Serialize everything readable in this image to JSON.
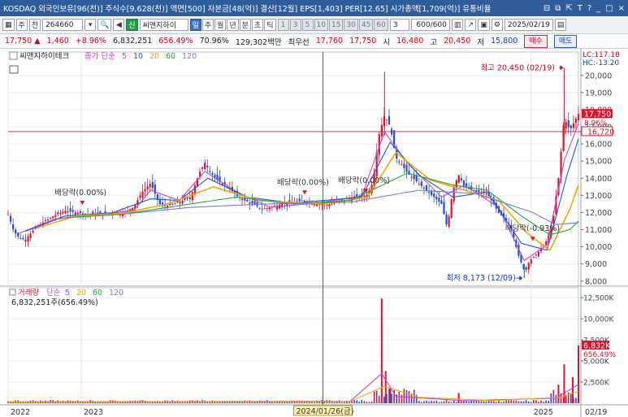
{
  "window": {
    "title": "KOSDAQ 외국인보유[96(천)] 주식수[9,628(천)] 액면[500] 자본금[48(억)] 결산[12월] EPS[1,403] PER[12.65] 시가총액[1,709(억)] 유통비율",
    "icons": [
      "pip-icon",
      "popout-icon",
      "pin-icon",
      "text-size-icon",
      "help-icon",
      "minimize-icon",
      "maximize-icon",
      "close-icon"
    ],
    "icon_glyphs": [
      "⊟",
      "⧉",
      "⇱",
      "T",
      "?",
      "_",
      "□",
      "×"
    ]
  },
  "toolbar": {
    "market": "주",
    "jeon": "전",
    "code": "264660",
    "sin": "신",
    "name": "씨앤지하이",
    "periods": [
      "일",
      "주",
      "월",
      "년",
      "분",
      "초",
      "틱"
    ],
    "minutes": [
      "1",
      "3",
      "5",
      "10",
      "15",
      "30",
      "45",
      "60"
    ],
    "step": "3",
    "count": "600/600",
    "date": "2025/02/19"
  },
  "quote": {
    "price": "17,750",
    "arrow": "▲",
    "change": "1,460",
    "change_pct": "+8.96%",
    "volume": "6,832,251",
    "vol_ratio": "656.49%",
    "turnover": "70.96%",
    "amount": "129,302백만",
    "bid_label": "최우선",
    "bid": "17,760",
    "ask": "17,750",
    "open_label": "시",
    "open": "16,480",
    "high_label": "고",
    "high": "20,450",
    "low_label": "저",
    "low": "15,800",
    "buy_label": "매수",
    "sell_label": "매도"
  },
  "chart_data": [
    {
      "type": "candlestick",
      "title": "씨앤지하이테크",
      "ma_label": "종가 단순",
      "ma_periods": [
        "5",
        "10",
        "20",
        "60",
        "120"
      ],
      "ma_colors": [
        "#d13fd1",
        "#1f57d8",
        "#f0a800",
        "#23a23c",
        "#7b7bd0"
      ],
      "y_ticks": [
        8000,
        9000,
        10000,
        11000,
        12000,
        13000,
        14000,
        15000,
        16000,
        17000,
        18000,
        19000,
        20000
      ],
      "y_tick_labels": [
        "8,000",
        "9,000",
        "10,000",
        "11,000",
        "12,000",
        "13,000",
        "14,000",
        "15,000",
        "16,000",
        "17,000",
        "18,000",
        "19,000",
        "20,000"
      ],
      "ylim": [
        7800,
        20700
      ],
      "x_labels": [
        {
          "label": "2022",
          "t": 0.0
        },
        {
          "label": "2023",
          "t": 0.128
        },
        {
          "label": "2025",
          "t": 0.917
        }
      ],
      "crosshair": {
        "date": "2024/01/26(금)",
        "t": 0.552,
        "price": 16720,
        "price_label": "16,720"
      },
      "last": {
        "price": 17750,
        "price_label": "17,750",
        "pct_label": "8.96%"
      },
      "lc_label": "LC:117.18",
      "hc_label": "HC:-13.20",
      "high": {
        "label": "최고 20,450 (02/19)",
        "value": 20450,
        "t": 0.975
      },
      "low": {
        "label": "최저 8,173 (12/09)",
        "value": 8173,
        "t": 0.905
      },
      "dividends": [
        {
          "label": "배당락(0.00%)",
          "t": 0.13,
          "value": 12450
        },
        {
          "label": "배당락(0.00%)",
          "t": 0.52,
          "value": 13050
        },
        {
          "label": "배당락(0.00%)",
          "t": 0.627,
          "value": 13150
        },
        {
          "label": "배당락(-0.93%)",
          "t": 0.92,
          "value": 10350
        }
      ],
      "close_path": [
        [
          0.0,
          11900
        ],
        [
          0.01,
          10900
        ],
        [
          0.02,
          10500
        ],
        [
          0.03,
          10400
        ],
        [
          0.045,
          11000
        ],
        [
          0.06,
          11400
        ],
        [
          0.08,
          11800
        ],
        [
          0.1,
          12100
        ],
        [
          0.12,
          12000
        ],
        [
          0.14,
          11900
        ],
        [
          0.16,
          11950
        ],
        [
          0.18,
          12000
        ],
        [
          0.2,
          11950
        ],
        [
          0.22,
          12300
        ],
        [
          0.235,
          13200
        ],
        [
          0.25,
          13700
        ],
        [
          0.265,
          12500
        ],
        [
          0.28,
          12400
        ],
        [
          0.3,
          12600
        ],
        [
          0.32,
          12900
        ],
        [
          0.335,
          14300
        ],
        [
          0.345,
          14900
        ],
        [
          0.355,
          14300
        ],
        [
          0.37,
          13800
        ],
        [
          0.385,
          13500
        ],
        [
          0.4,
          13000
        ],
        [
          0.415,
          12700
        ],
        [
          0.43,
          12500
        ],
        [
          0.445,
          12200
        ],
        [
          0.46,
          12300
        ],
        [
          0.48,
          12500
        ],
        [
          0.5,
          12600
        ],
        [
          0.52,
          12700
        ],
        [
          0.54,
          12500
        ],
        [
          0.56,
          12450
        ],
        [
          0.58,
          12650
        ],
        [
          0.6,
          12850
        ],
        [
          0.62,
          12950
        ],
        [
          0.63,
          13050
        ],
        [
          0.64,
          13800
        ],
        [
          0.65,
          16500
        ],
        [
          0.66,
          17700
        ],
        [
          0.67,
          17000
        ],
        [
          0.68,
          15200
        ],
        [
          0.69,
          14800
        ],
        [
          0.7,
          14300
        ],
        [
          0.72,
          13700
        ],
        [
          0.74,
          13100
        ],
        [
          0.76,
          12500
        ],
        [
          0.77,
          11100
        ],
        [
          0.78,
          13400
        ],
        [
          0.79,
          14200
        ],
        [
          0.8,
          13500
        ],
        [
          0.82,
          13200
        ],
        [
          0.84,
          13100
        ],
        [
          0.86,
          12000
        ],
        [
          0.88,
          11300
        ],
        [
          0.895,
          9500
        ],
        [
          0.905,
          8600
        ],
        [
          0.915,
          9200
        ],
        [
          0.93,
          9700
        ],
        [
          0.945,
          10400
        ],
        [
          0.955,
          11500
        ],
        [
          0.965,
          14000
        ],
        [
          0.975,
          17500
        ],
        [
          0.985,
          16800
        ],
        [
          1.0,
          17750
        ]
      ],
      "ma_paths": [
        [
          [
            0.02,
            10800
          ],
          [
            0.08,
            11600
          ],
          [
            0.15,
            11900
          ],
          [
            0.22,
            12100
          ],
          [
            0.25,
            13300
          ],
          [
            0.3,
            12700
          ],
          [
            0.345,
            14400
          ],
          [
            0.4,
            13200
          ],
          [
            0.46,
            12300
          ],
          [
            0.54,
            12550
          ],
          [
            0.62,
            12950
          ],
          [
            0.66,
            16700
          ],
          [
            0.7,
            14900
          ],
          [
            0.76,
            12900
          ],
          [
            0.8,
            13600
          ],
          [
            0.86,
            12300
          ],
          [
            0.905,
            9200
          ],
          [
            0.945,
            10100
          ],
          [
            0.975,
            15000
          ],
          [
            1.0,
            17200
          ]
        ],
        [
          [
            0.03,
            10900
          ],
          [
            0.1,
            11800
          ],
          [
            0.18,
            11950
          ],
          [
            0.25,
            12800
          ],
          [
            0.3,
            12700
          ],
          [
            0.35,
            14000
          ],
          [
            0.42,
            12900
          ],
          [
            0.5,
            12550
          ],
          [
            0.62,
            12900
          ],
          [
            0.67,
            16100
          ],
          [
            0.72,
            14200
          ],
          [
            0.78,
            12900
          ],
          [
            0.84,
            13200
          ],
          [
            0.9,
            10200
          ],
          [
            0.945,
            9800
          ],
          [
            0.98,
            14200
          ],
          [
            1.0,
            16300
          ]
        ],
        [
          [
            0.05,
            11100
          ],
          [
            0.12,
            11800
          ],
          [
            0.2,
            11950
          ],
          [
            0.28,
            12500
          ],
          [
            0.36,
            13500
          ],
          [
            0.44,
            12700
          ],
          [
            0.55,
            12500
          ],
          [
            0.63,
            12900
          ],
          [
            0.68,
            15500
          ],
          [
            0.74,
            13900
          ],
          [
            0.8,
            13300
          ],
          [
            0.86,
            12700
          ],
          [
            0.91,
            10800
          ],
          [
            0.95,
            9800
          ],
          [
            0.985,
            12200
          ],
          [
            1.0,
            13600
          ]
        ],
        [
          [
            0.1,
            11700
          ],
          [
            0.2,
            11900
          ],
          [
            0.3,
            12400
          ],
          [
            0.4,
            12900
          ],
          [
            0.5,
            12500
          ],
          [
            0.6,
            12700
          ],
          [
            0.7,
            14300
          ],
          [
            0.78,
            13600
          ],
          [
            0.84,
            13300
          ],
          [
            0.9,
            11800
          ],
          [
            0.95,
            10700
          ],
          [
            0.985,
            11000
          ],
          [
            1.0,
            11500
          ]
        ],
        [
          [
            0.2,
            11900
          ],
          [
            0.32,
            12300
          ],
          [
            0.45,
            12500
          ],
          [
            0.6,
            12600
          ],
          [
            0.72,
            13300
          ],
          [
            0.82,
            13100
          ],
          [
            0.92,
            12000
          ],
          [
            0.96,
            11300
          ],
          [
            1.0,
            11400
          ]
        ]
      ]
    },
    {
      "type": "bar",
      "title": "거래량",
      "ma_label": "단순",
      "ma_periods": [
        "5",
        "20",
        "60",
        "120"
      ],
      "ma_colors": [
        "#d13fd1",
        "#f0a800",
        "#23a23c",
        "#7b7bd0"
      ],
      "value_label": "6,832,251주(656.49%)",
      "y_ticks": [
        2500,
        5000,
        7500,
        10000,
        12500
      ],
      "y_tick_labels": [
        "2,500K",
        "5,000K",
        "7,500K",
        "10,000K",
        "12,500K"
      ],
      "ylim": [
        0,
        12900
      ],
      "last": {
        "value": 6832,
        "value_label": "6,832K",
        "pct_label": "656.49%"
      },
      "date_label": "02/19",
      "spikes": [
        {
          "t": 0.655,
          "value": 12400
        },
        {
          "t": 0.662,
          "value": 3800
        },
        {
          "t": 0.67,
          "value": 1800
        },
        {
          "t": 0.79,
          "value": 1200
        },
        {
          "t": 0.965,
          "value": 2200
        },
        {
          "t": 0.975,
          "value": 4600
        },
        {
          "t": 0.99,
          "value": 3100
        },
        {
          "t": 1.0,
          "value": 6832
        }
      ],
      "ma_paths": [
        [
          [
            0.0,
            150
          ],
          [
            0.3,
            180
          ],
          [
            0.6,
            250
          ],
          [
            0.655,
            3500
          ],
          [
            0.68,
            800
          ],
          [
            0.8,
            300
          ],
          [
            0.96,
            600
          ],
          [
            1.0,
            2200
          ]
        ],
        [
          [
            0.0,
            160
          ],
          [
            0.6,
            220
          ],
          [
            0.66,
            2000
          ],
          [
            0.72,
            700
          ],
          [
            0.85,
            300
          ],
          [
            0.97,
            700
          ],
          [
            1.0,
            1400
          ]
        ]
      ]
    }
  ]
}
